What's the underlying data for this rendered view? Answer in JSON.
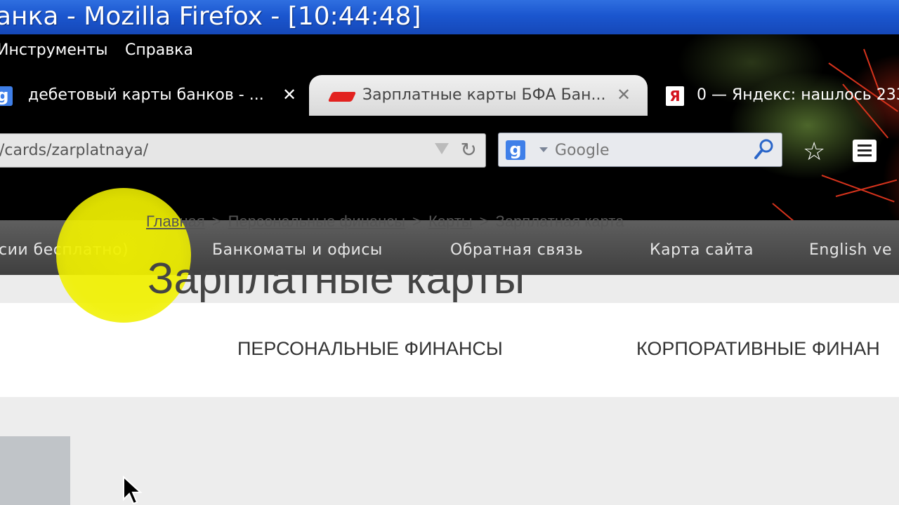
{
  "window": {
    "title": "анка - Mozilla Firefox - [10:44:48]"
  },
  "menubar": {
    "items": [
      "Инструменты",
      "Справка"
    ]
  },
  "tabs": [
    {
      "label": "дебетовый карты банков - ...",
      "icon": "google-icon",
      "active": false
    },
    {
      "label": "Зарплатные карты БФА Бан...",
      "icon": "bfa-bank-icon",
      "active": true
    },
    {
      "label": "0 — Яндекс: нашлось 233",
      "icon": "yandex-icon",
      "active": false
    }
  ],
  "icons": {
    "google_letter": "g",
    "yandex_letter": "Я",
    "close_glyph": "✕",
    "reload_glyph": "↻",
    "star_glyph": "☆"
  },
  "urlbar": {
    "value": "/cards/zarplatnaya/"
  },
  "searchbar": {
    "placeholder": "Google"
  },
  "site": {
    "topnav": [
      "сии бесплатно)",
      "Банкоматы и офисы",
      "Обратная связь",
      "Карта сайта",
      "English ve"
    ],
    "categories": [
      "ПЕРСОНАЛЬНЫЕ ФИНАНСЫ",
      "КОРПОРАТИВНЫЕ ФИНАН"
    ],
    "breadcrumb": {
      "links": [
        "Главная",
        "Персональные финансы",
        "Карты"
      ],
      "current": "Зарплатная карта",
      "separator": ">"
    },
    "page_title": "Зарплатные карты"
  },
  "colors": {
    "titlebar": "#1b56cf",
    "nav_dark": "#4a4a4a",
    "highlight": "#f0f000"
  }
}
